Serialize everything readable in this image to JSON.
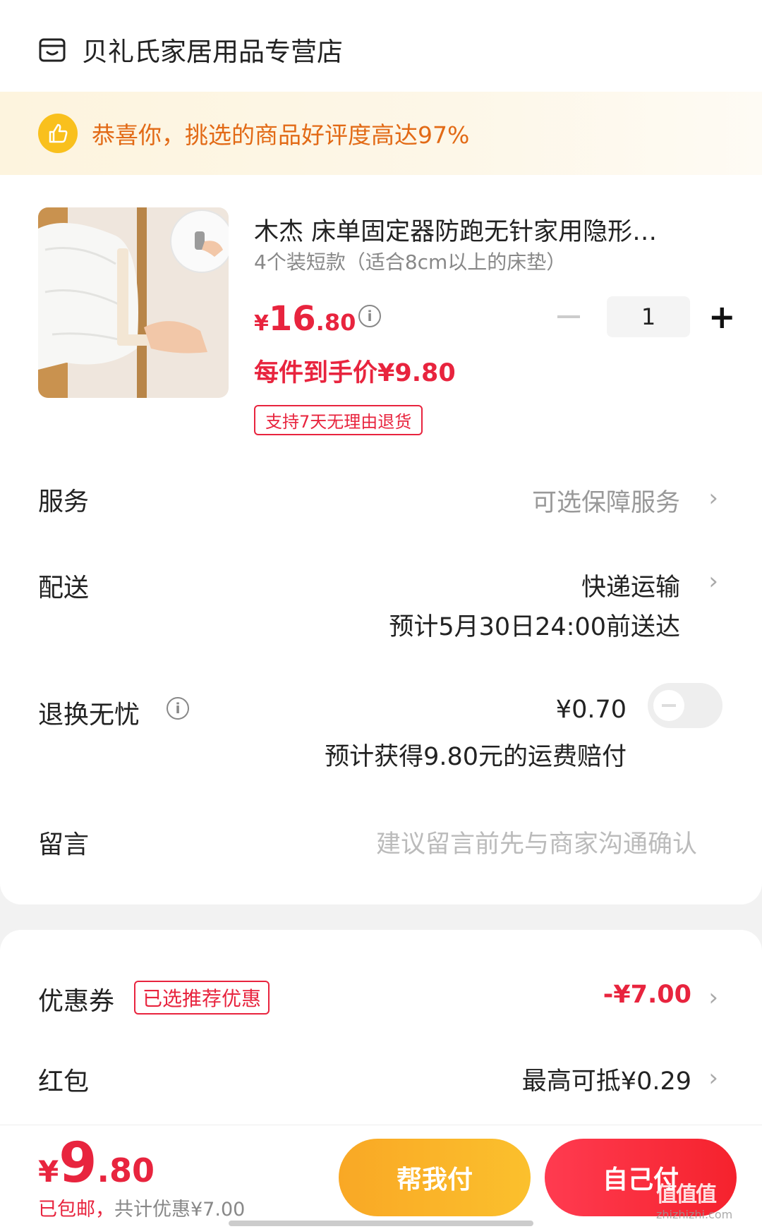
{
  "store": {
    "name": "贝礼氏家居用品专营店",
    "icon": "store-icon"
  },
  "rating_banner": {
    "text": "恭喜你，挑选的商品好评度高达97%",
    "icon": "thumbs-up-icon",
    "color": "#e26a16"
  },
  "product": {
    "title": "木杰 床单固定器防跑无针家用隐形…",
    "spec": "4个装短款（适合8cm以上的床垫）",
    "price_symbol": "¥",
    "price_int": "16",
    "price_dec": ".80",
    "final_price": "每件到手价¥9.80",
    "return_tag": "支持7天无理由退货",
    "quantity": "1"
  },
  "rows": {
    "service": {
      "label": "服务",
      "value": "可选保障服务"
    },
    "delivery": {
      "label": "配送",
      "value": "快递运输",
      "eta": "预计5月30日24:00前送达"
    },
    "returns": {
      "label": "退换无忧",
      "price": "¥0.70",
      "note": "预计获得9.80元的运费赔付",
      "toggle_on": false
    },
    "message": {
      "label": "留言",
      "placeholder": "建议留言前先与商家沟通确认"
    }
  },
  "coupon": {
    "label": "优惠券",
    "tag": "已选推荐优惠",
    "value": "-¥7.00"
  },
  "red_packet": {
    "label": "红包",
    "value": "最高可抵¥0.29"
  },
  "footer": {
    "total_symbol": "¥",
    "total_int": "9",
    "total_dec": ".80",
    "shipping": "已包邮，",
    "discount": "共计优惠¥7.00",
    "help_pay": "帮我付",
    "self_pay": "自己付"
  },
  "watermark": {
    "text": "值值值",
    "sub": "zhizhizhi.com"
  },
  "colors": {
    "accent": "#e8243e",
    "banner_bg": "#fdf4de",
    "help_btn": "#f9a825"
  }
}
